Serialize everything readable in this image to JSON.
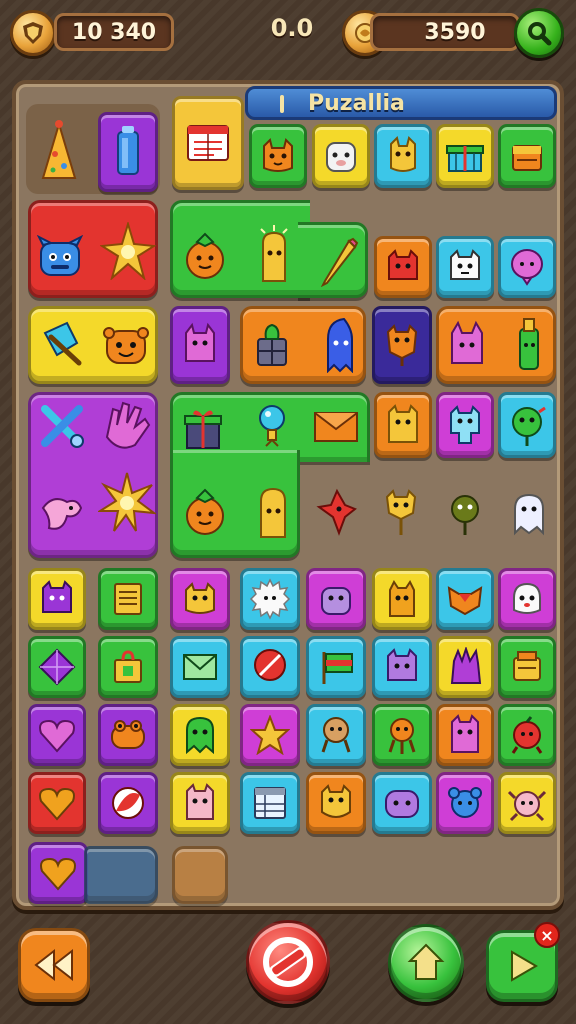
{
  "hud": {
    "left_value": "10 340",
    "center_value": "0.0",
    "right_value": "3590"
  },
  "board": {
    "title": "Puzallia"
  },
  "icons": {
    "left_coin": "shield-icon",
    "right_coin": "gold-coin-icon",
    "top_right_button": "search-icon",
    "rewind_button": "rewind-icon",
    "stop_button": "no-entry-icon",
    "home_button": "home-star-icon",
    "play_button": "play-icon",
    "close_badge": "close-icon"
  },
  "badge": {
    "close_label": "×"
  },
  "colors": {
    "red": "#e3342f",
    "green": "#38c23d",
    "yellow": "#f4d92a",
    "orange": "#f0861e",
    "purple": "#9a35d6",
    "magenta": "#cf3ed6",
    "cyan": "#3cc6e8",
    "navy": "#3a2a9a",
    "board": "#8b7660"
  }
}
